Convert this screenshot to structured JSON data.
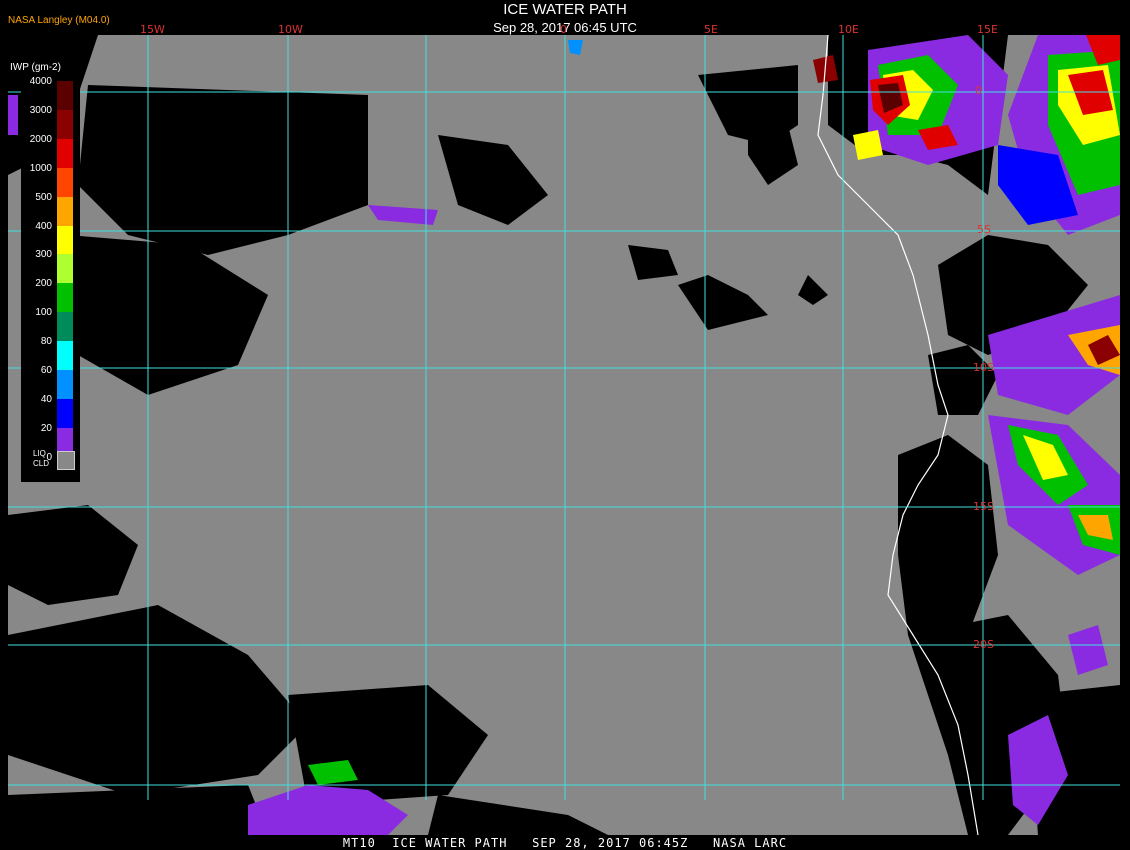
{
  "header": {
    "title": "ICE WATER PATH",
    "subtitle": "Sep 28, 2017 06:45 UTC",
    "brand": "NASA Langley (M04.0)"
  },
  "longitudes": [
    "15W",
    "10W",
    "0",
    "5E",
    "10E",
    "15E"
  ],
  "latitudes": [
    "0",
    "5S",
    "10S",
    "15S",
    "20S"
  ],
  "legend": {
    "title": "IWP (gm-2)",
    "ticks": [
      "4000",
      "3000",
      "2000",
      "1000",
      "500",
      "400",
      "300",
      "200",
      "100",
      "80",
      "60",
      "40",
      "20",
      "0"
    ],
    "colors": [
      "#5a0000",
      "#8b0000",
      "#e00000",
      "#ff4500",
      "#ffa500",
      "#ffff00",
      "#adff2f",
      "#00c000",
      "#008b5a",
      "#00ffff",
      "#0090ff",
      "#0000ff",
      "#8a2be2"
    ],
    "liq_label_1": "LIQ",
    "liq_label_2": "CLD",
    "liq_color": "#888888"
  },
  "map_colors": {
    "background": "#888888",
    "clear": "#000000",
    "grid": "#40e0e0",
    "coast": "#ffffff"
  },
  "footer": "MT10  ICE WATER PATH   SEP 28, 2017 06:45Z   NASA LARC"
}
